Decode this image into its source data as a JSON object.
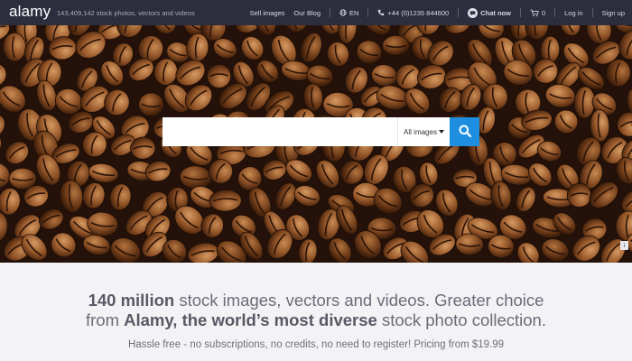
{
  "header": {
    "logo": "alamy",
    "tagline": "143,409,142  stock photos, vectors and videos",
    "nav": {
      "sell": "Sell images",
      "blog": "Our Blog",
      "lang": "EN",
      "phone": "+44 (0)1235 844600",
      "chat": "Chat now",
      "cart_count": "0",
      "login": "Log in",
      "signup": "Sign up"
    }
  },
  "search": {
    "placeholder": "",
    "filter_selected": "All images"
  },
  "promo": {
    "line1_bold1": "140 million",
    "line1_text": " stock images, vectors and videos. Greater choice",
    "line2_text1": "from ",
    "line2_bold": "Alamy, the world’s most diverse",
    "line2_text2": " stock photo collection.",
    "subline": "Hassle free - no subscriptions, no credits, no need to register! Pricing from $19.99"
  },
  "colors": {
    "topbar": "#2c2e3e",
    "search_button": "#1e8fe0",
    "background": "#f3f3f6"
  },
  "icons": [
    "globe-icon",
    "phone-icon",
    "chat-icon",
    "cart-icon",
    "search-icon",
    "info-icon"
  ]
}
